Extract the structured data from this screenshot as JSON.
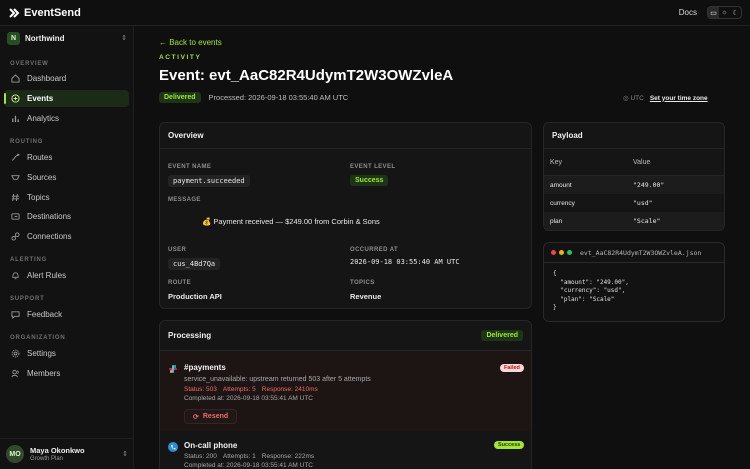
{
  "app": {
    "name": "EventSend",
    "docs_label": "Docs"
  },
  "theme_toggle": [
    "monitor-icon",
    "sun-icon",
    "moon-icon"
  ],
  "org": {
    "initial": "N",
    "name": "Northwind"
  },
  "nav": {
    "sections": [
      {
        "label": "OVERVIEW",
        "items": [
          {
            "label": "Dashboard",
            "icon": "home-icon"
          },
          {
            "label": "Events",
            "icon": "events-icon",
            "active": true
          },
          {
            "label": "Analytics",
            "icon": "bar-chart-icon"
          }
        ]
      },
      {
        "label": "ROUTING",
        "items": [
          {
            "label": "Routes",
            "icon": "routes-icon"
          },
          {
            "label": "Sources",
            "icon": "sources-icon"
          },
          {
            "label": "Topics",
            "icon": "hash-icon"
          },
          {
            "label": "Destinations",
            "icon": "destinations-icon"
          },
          {
            "label": "Connections",
            "icon": "link-icon"
          }
        ]
      },
      {
        "label": "ALERTING",
        "items": [
          {
            "label": "Alert Rules",
            "icon": "bell-icon"
          }
        ]
      },
      {
        "label": "SUPPORT",
        "items": [
          {
            "label": "Feedback",
            "icon": "message-icon"
          }
        ]
      },
      {
        "label": "ORGANIZATION",
        "items": [
          {
            "label": "Settings",
            "icon": "gear-icon"
          },
          {
            "label": "Members",
            "icon": "users-icon"
          }
        ]
      }
    ]
  },
  "user": {
    "initials": "MO",
    "name": "Maya Okonkwo",
    "plan": "Growth Plan"
  },
  "header": {
    "back_label": "← Back to events",
    "eyebrow": "ACTIVITY",
    "title": "Event: evt_AaC82R4UdymT2W3OWZvleA",
    "status": "Delivered",
    "processed": "Processed: 2026-09-18 03:55:40 AM UTC",
    "tz_label": "UTC",
    "tz_link": "Set your time zone"
  },
  "overview": {
    "title": "Overview",
    "event_name_label": "EVENT NAME",
    "event_name": "payment.succeeded",
    "event_level_label": "EVENT LEVEL",
    "event_level": "Success",
    "message_label": "MESSAGE",
    "message": "💰 Payment received — $249.00 from Corbin & Sons",
    "user_label": "USER",
    "user": "cus_4Bd7Qa",
    "occurred_label": "OCCURRED AT",
    "occurred": "2026-09-18 03:55:40 AM UTC",
    "route_label": "ROUTE",
    "route": "Production API",
    "topics_label": "TOPICS",
    "topics": "Revenue"
  },
  "payload": {
    "title": "Payload",
    "col_key": "Key",
    "col_value": "Value",
    "rows": [
      {
        "k": "amount",
        "v": "\"249.00\""
      },
      {
        "k": "currency",
        "v": "\"usd\""
      },
      {
        "k": "plan",
        "v": "\"Scale\""
      }
    ],
    "file_name": "evt_AaC82R4UdymT2W3OWZvleA.json",
    "json": "{\n  \"amount\": \"249.00\",\n  \"currency\": \"usd\",\n  \"plan\": \"Scale\"\n}"
  },
  "processing": {
    "title": "Processing",
    "status": "Delivered",
    "items": [
      {
        "name": "#payments",
        "badge": "Failed",
        "error": "service_unavailable: upstream returned 503 after 5 attempts",
        "status": "Status: 503",
        "attempts": "Attempts: 5",
        "response": "Response: 2410ms",
        "completed": "Completed at: 2026-09-18 03:55:41 AM UTC",
        "action": "Resend"
      },
      {
        "name": "On-call phone",
        "badge": "Success",
        "status": "Status: 200",
        "attempts": "Attempts: 1",
        "response": "Response: 222ms",
        "completed": "Completed at: 2026-09-18 03:55:41 AM UTC"
      }
    ]
  },
  "colors": {
    "accent": "#a3e635",
    "error": "#ef6b6b",
    "background": "#0f0f0f"
  }
}
